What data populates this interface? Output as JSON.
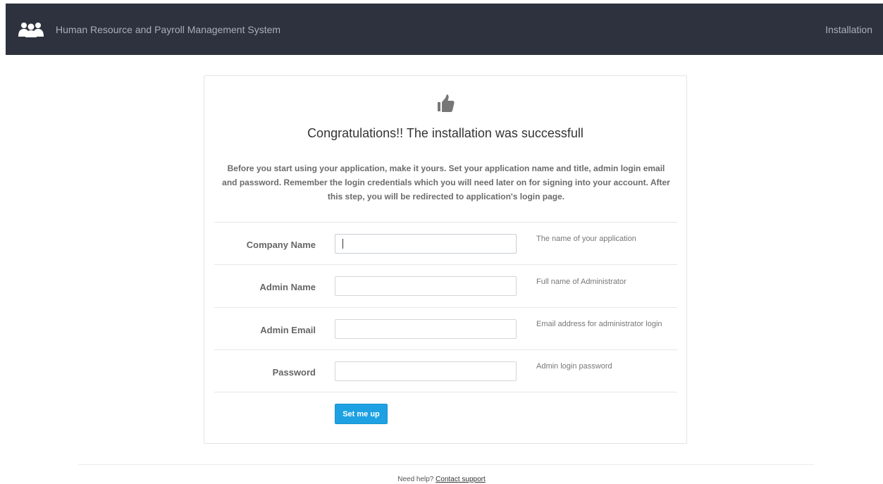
{
  "header": {
    "logo_icon": "users-icon",
    "app_title": "Human Resource and Payroll Management System",
    "right_link": "Installation",
    "background": "#2d323e"
  },
  "panel": {
    "icon": "thumbs-up-icon",
    "heading": "Congratulations!! The installation was successfull",
    "intro": "Before you start using your application, make it yours. Set your application name and title, admin login email and password. Remember the login credentials which you will need later on for signing into your account. After this step, you will be redirected to application's login page."
  },
  "form": {
    "fields": [
      {
        "label": "Company Name",
        "value": "",
        "placeholder": "",
        "help": "The name of your application",
        "focused": true
      },
      {
        "label": "Admin Name",
        "value": "",
        "placeholder": "",
        "help": "Full name of Administrator"
      },
      {
        "label": "Admin Email",
        "value": "",
        "placeholder": "",
        "help": "Email address for administrator login"
      },
      {
        "label": "Password",
        "value": "",
        "placeholder": "",
        "help": "Admin login password"
      }
    ],
    "submit_label": "Set me up",
    "accent": "#1da1e2"
  },
  "footer": {
    "prefix": "Need help?",
    "link": "Contact support"
  }
}
